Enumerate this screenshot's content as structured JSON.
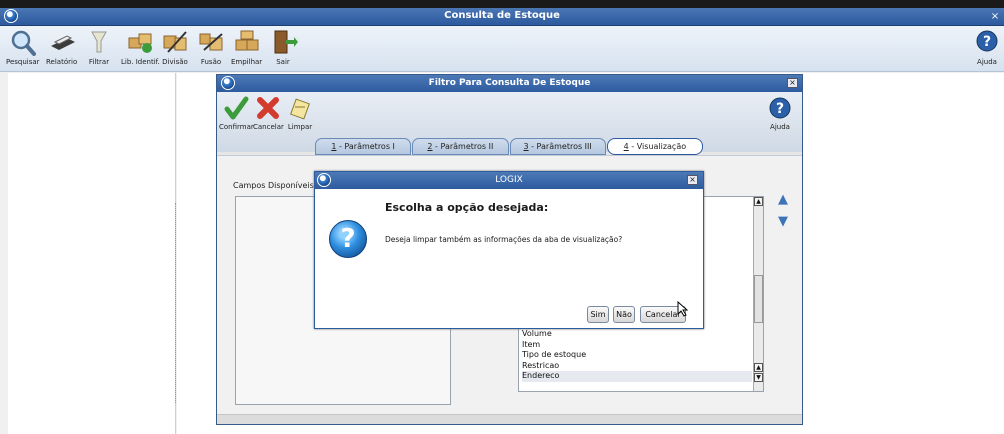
{
  "app": {
    "title": "Consulta de Estoque",
    "close": "×",
    "toolbar": [
      {
        "label": "Pesquisar",
        "icon": "magnifier-icon"
      },
      {
        "label": "Relatório",
        "icon": "printer-icon"
      },
      {
        "label": "Filtrar",
        "icon": "funnel-icon"
      },
      {
        "label": "Lib. Identif.",
        "icon": "boxes-icon"
      },
      {
        "label": "Divisão",
        "icon": "boxes-cut-icon"
      },
      {
        "label": "Fusão",
        "icon": "boxes-merge-icon"
      },
      {
        "label": "Empilhar",
        "icon": "stack-boxes-icon"
      },
      {
        "label": "Sair",
        "icon": "exit-door-icon"
      },
      {
        "label": "Ajuda",
        "icon": "help-icon"
      }
    ]
  },
  "filter_dialog": {
    "title": "Filtro Para Consulta De Estoque",
    "close": "×",
    "toolbar": [
      {
        "label": "Confirmar",
        "icon": "checkmark-icon"
      },
      {
        "label": "Cancelar",
        "icon": "red-x-icon"
      },
      {
        "label": "Limpar",
        "icon": "eraser-icon"
      },
      {
        "label": "Ajuda",
        "icon": "help-icon"
      }
    ],
    "tabs": [
      {
        "num": "1",
        "label": " - Parâmetros I"
      },
      {
        "num": "2",
        "label": " - Parâmetros II"
      },
      {
        "num": "3",
        "label": " - Parâmetros III"
      },
      {
        "num": "4",
        "label": " - Visualização"
      }
    ],
    "active_tab": "4 - Visualização",
    "campos_label": "Campos Disponíveis",
    "selected_fields": [
      "Volume",
      "Item",
      "Tipo de estoque",
      "Restricao",
      "Endereco"
    ]
  },
  "logix_dialog": {
    "title": "LOGIX",
    "close": "×",
    "heading": "Escolha a opção desejada:",
    "message": "Deseja limpar também as informações da aba de visualização?",
    "buttons": {
      "sim": "Sim",
      "nao": "Não",
      "cancelar": "Cancelar"
    }
  },
  "colors": {
    "title_bar": "#2d5b9f",
    "accent": "#3d74b8"
  }
}
